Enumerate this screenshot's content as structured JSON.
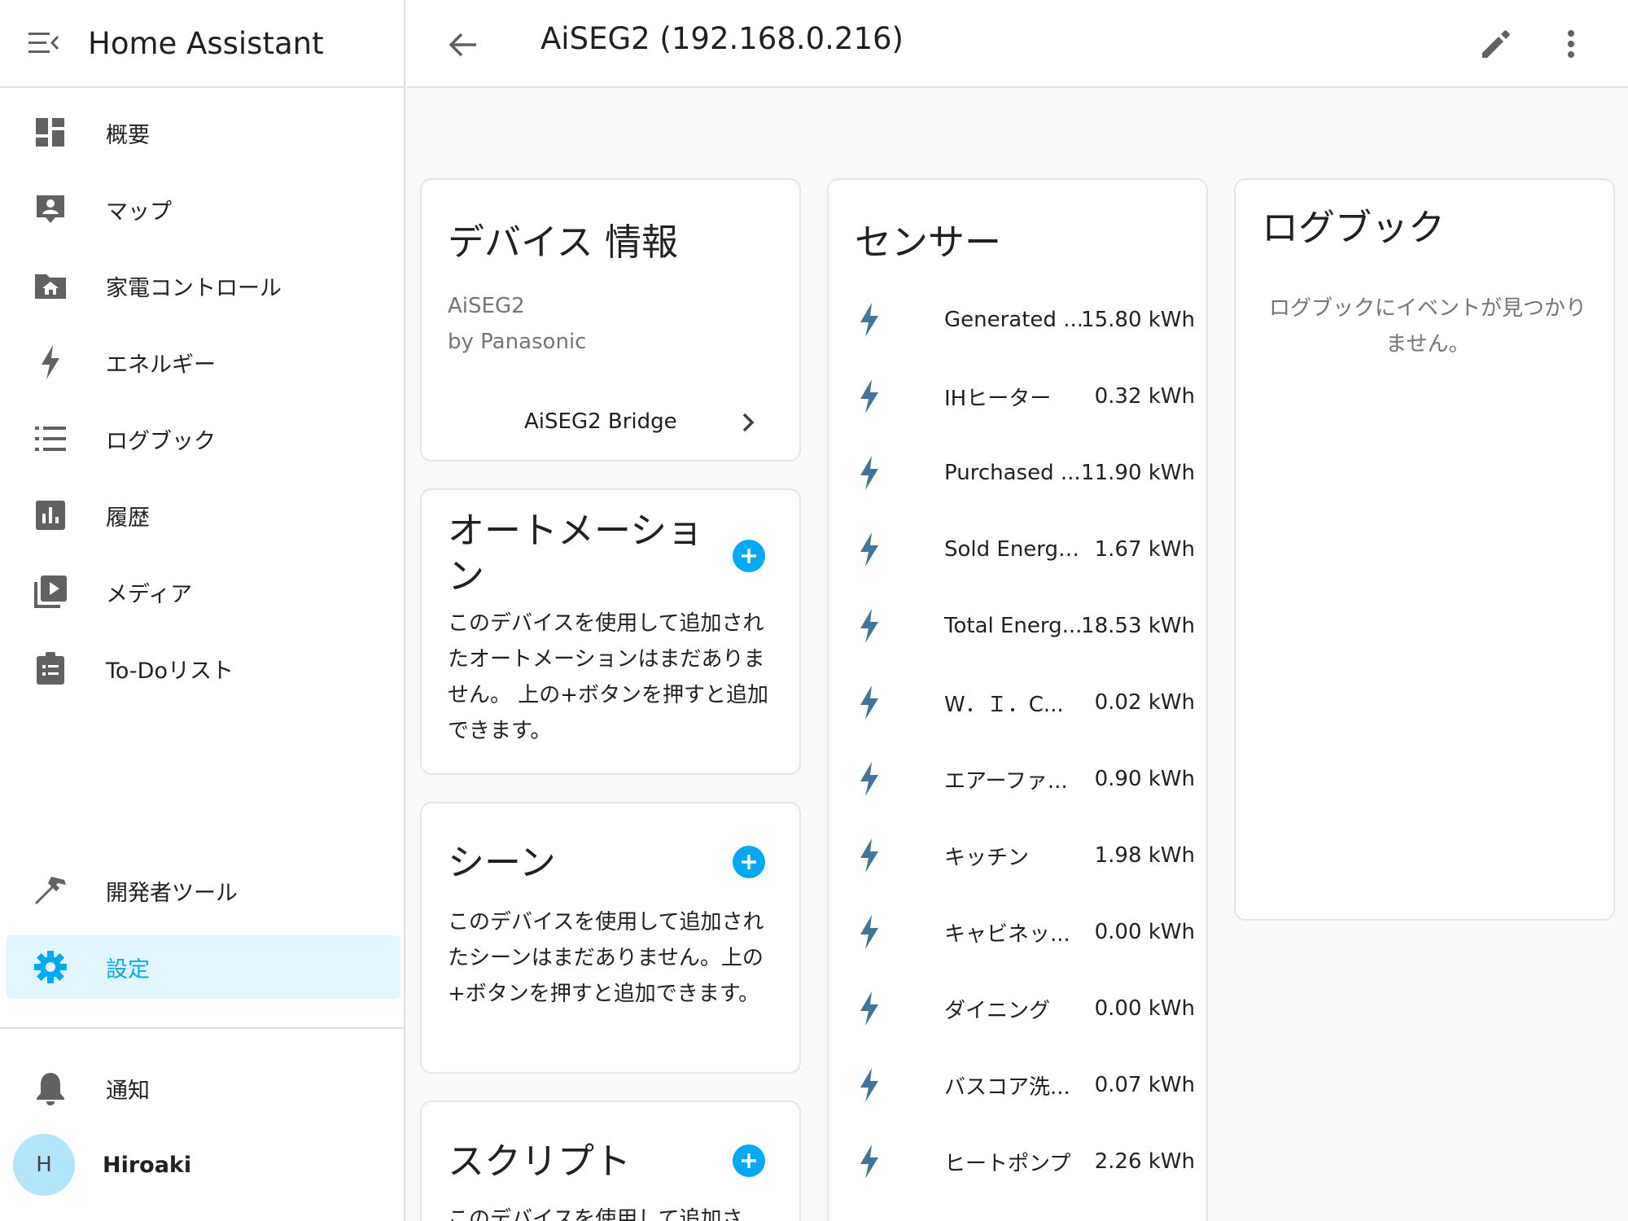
{
  "app": {
    "title": "Home Assistant"
  },
  "sidebar": {
    "items": [
      {
        "label": "概要",
        "icon": "dashboard-icon"
      },
      {
        "label": "マップ",
        "icon": "map-account-icon"
      },
      {
        "label": "家電コントロール",
        "icon": "home-folder-icon"
      },
      {
        "label": "エネルギー",
        "icon": "lightning-icon"
      },
      {
        "label": "ログブック",
        "icon": "list-icon"
      },
      {
        "label": "履歴",
        "icon": "chart-box-icon"
      },
      {
        "label": "メディア",
        "icon": "play-box-icon"
      },
      {
        "label": "To-Doリスト",
        "icon": "clipboard-list-icon"
      }
    ],
    "dev_tools": {
      "label": "開発者ツール",
      "icon": "hammer-icon"
    },
    "settings": {
      "label": "設定",
      "icon": "gear-icon",
      "active": true
    },
    "notifications": {
      "label": "通知",
      "icon": "bell-icon"
    },
    "user": {
      "initial": "H",
      "name": "Hiroaki"
    }
  },
  "topbar": {
    "title": "AiSEG2 (192.168.0.216)"
  },
  "device_info": {
    "heading": "デバイス 情報",
    "model": "AiSEG2",
    "manufacturer": "by Panasonic",
    "via_device": "AiSEG2 Bridge"
  },
  "automations": {
    "heading": "オートメーション",
    "desc": "このデバイスを使用して追加されたオートメーションはまだありません。 上の+ボタンを押すと追加できます。"
  },
  "scenes": {
    "heading": "シーン",
    "desc": "このデバイスを使用して追加されたシーンはまだありません。上の+ボタンを押すと追加できます。"
  },
  "scripts": {
    "heading": "スクリプト",
    "desc": "このデバイスを使用して追加さ"
  },
  "sensors": {
    "heading": "センサー",
    "rows": [
      {
        "name": "Generated ...",
        "value": "15.80 kWh"
      },
      {
        "name": "IHヒーター",
        "value": "0.32 kWh"
      },
      {
        "name": "Purchased ...",
        "value": "11.90 kWh"
      },
      {
        "name": "Sold Energy ...",
        "value": "1.67 kWh"
      },
      {
        "name": "Total Energ...",
        "value": "18.53 kWh"
      },
      {
        "name": "W．Ｉ．C...",
        "value": "0.02 kWh"
      },
      {
        "name": "エアーファ...",
        "value": "0.90 kWh"
      },
      {
        "name": "キッチン",
        "value": "1.98 kWh"
      },
      {
        "name": "キャビネッ...",
        "value": "0.00 kWh"
      },
      {
        "name": "ダイニング",
        "value": "0.00 kWh"
      },
      {
        "name": "バスコア洗...",
        "value": "0.07 kWh"
      },
      {
        "name": "ヒートポンプ",
        "value": "2.26 kWh"
      }
    ]
  },
  "logbook": {
    "heading": "ログブック",
    "empty": "ログブックにイベントが見つかりません。"
  },
  "colors": {
    "accent": "#03a9f4",
    "icon": "#44739e",
    "active_bg": "#e1f5fe"
  }
}
